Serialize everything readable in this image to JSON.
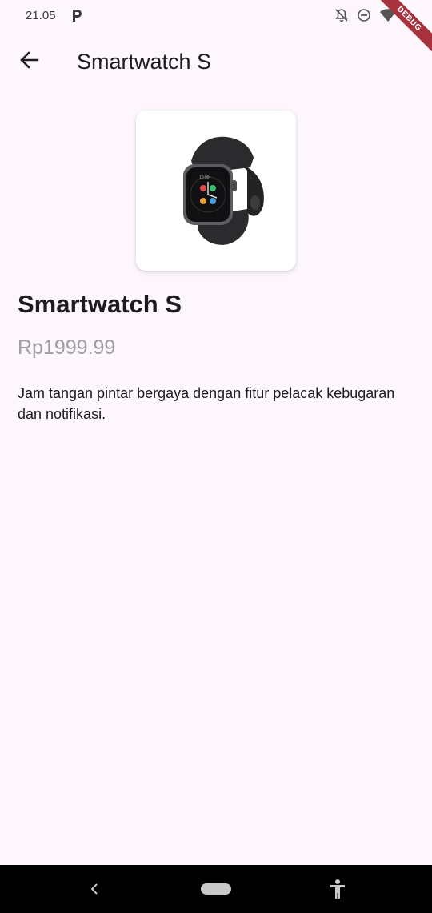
{
  "status_bar": {
    "time": "21.05",
    "icons": [
      "p-app-icon",
      "notifications-off-icon",
      "do-not-disturb-icon",
      "wifi-icon"
    ]
  },
  "debug_banner": {
    "label": "DEBUG",
    "color": "#a5323d"
  },
  "app_bar": {
    "back_icon": "arrow-back-icon",
    "title": "Smartwatch S"
  },
  "product": {
    "image_description_icon": "smartwatch-image",
    "name": "Smartwatch S",
    "price": "Rp1999.99",
    "description": "Jam tangan pintar bergaya dengan fitur pelacak kebugaran dan notifikasi."
  },
  "nav_bar": {
    "icons": [
      "back-chevron-icon",
      "home-pill-icon",
      "accessibility-icon"
    ]
  },
  "colors": {
    "background": "#fdf6fd",
    "text_primary": "#1d1b20",
    "price_text": "#9e9e9e",
    "nav_bar": "#000000"
  }
}
